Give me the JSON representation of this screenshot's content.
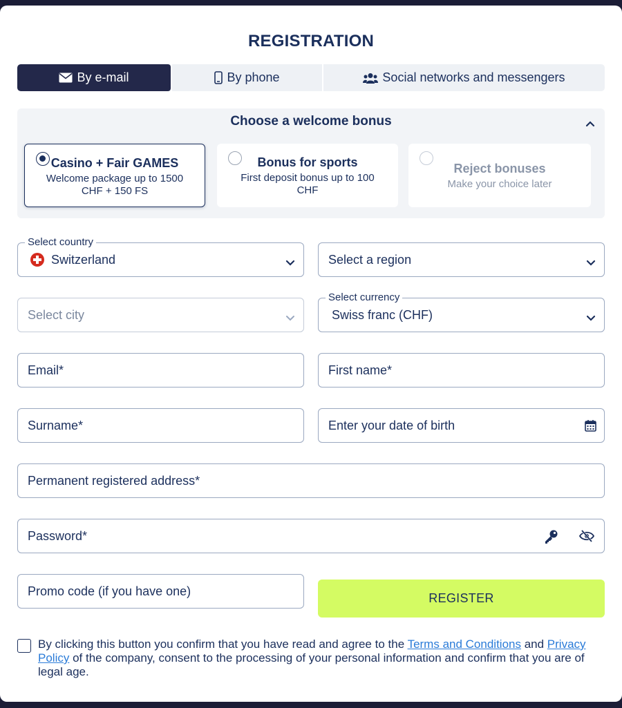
{
  "title": "REGISTRATION",
  "tabs": [
    {
      "label": "By e-mail",
      "icon": "envelope-icon",
      "active": true
    },
    {
      "label": "By phone",
      "icon": "phone-icon",
      "active": false
    },
    {
      "label": "Social networks and messengers",
      "icon": "users-icon",
      "active": false
    }
  ],
  "bonus": {
    "heading": "Choose a welcome bonus",
    "options": [
      {
        "name": "Casino + Fair GAMES",
        "desc": "Welcome package up to 1500 CHF + 150 FS",
        "selected": true
      },
      {
        "name": "Bonus for sports",
        "desc": "First deposit bonus up to 100 CHF",
        "selected": false
      },
      {
        "name": "Reject bonuses",
        "desc": "Make your choice later",
        "selected": false
      }
    ]
  },
  "form": {
    "country_label": "Select country",
    "country_value": "Switzerland",
    "region_placeholder": "Select a region",
    "city_placeholder": "Select city",
    "currency_label": "Select currency",
    "currency_value": "Swiss franc (CHF)",
    "email_placeholder": "Email*",
    "first_name_placeholder": "First name*",
    "surname_placeholder": "Surname*",
    "dob_placeholder": "Enter your date of birth",
    "address_placeholder": "Permanent registered address*",
    "password_placeholder": "Password*",
    "promo_placeholder": "Promo code (if you have one)"
  },
  "register_label": "REGISTER",
  "agreement": {
    "before": "By clicking this button you confirm that you have read and agree to the ",
    "terms_link": "Terms and Conditions",
    "middle": " and ",
    "privacy_link": "Privacy Policy",
    "after": " of the company, consent to the processing of your personal information and confirm that you are of legal age."
  },
  "colors": {
    "brand_dark": "#1b2f5c",
    "tab_active": "#23284a",
    "register_button": "#d4fb63",
    "link": "#2a7bd8",
    "flag_red": "#d52b1e"
  }
}
